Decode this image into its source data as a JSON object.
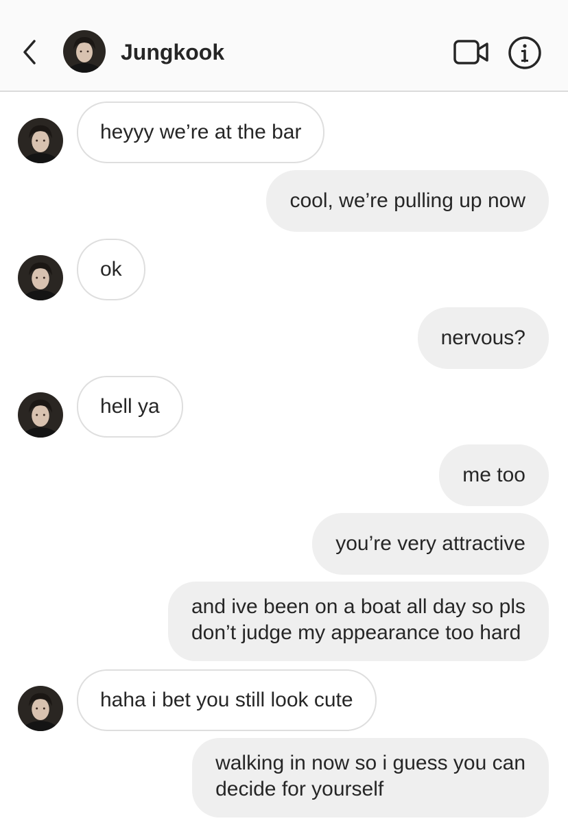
{
  "header": {
    "contact_name": "Jungkook"
  },
  "messages": [
    {
      "id": "m1",
      "side": "in",
      "text": "heyyy we’re at the bar"
    },
    {
      "id": "m2",
      "side": "out",
      "text": "cool, we’re pulling up now"
    },
    {
      "id": "m3",
      "side": "in",
      "text": "ok"
    },
    {
      "id": "m4",
      "side": "out",
      "text": "nervous?"
    },
    {
      "id": "m5",
      "side": "in",
      "text": "hell ya"
    },
    {
      "id": "m6",
      "side": "out",
      "text": "me too"
    },
    {
      "id": "m7",
      "side": "out",
      "text": "you’re very attractive"
    },
    {
      "id": "m8",
      "side": "out",
      "lines": [
        "and ive been on a boat all day so pls",
        "don’t judge my appearance too hard"
      ]
    },
    {
      "id": "m9",
      "side": "in",
      "text": "haha i bet you still look cute"
    },
    {
      "id": "m10",
      "side": "out",
      "lines": [
        "walking in now so i guess you can",
        "decide for yourself"
      ]
    }
  ],
  "icons": {
    "back": "chevron-left-icon",
    "video": "video-camera-icon",
    "info": "info-icon"
  },
  "colors": {
    "header_bg": "#fafafa",
    "incoming_bubble_border": "#dedede",
    "outgoing_bubble_bg": "#efefef",
    "text": "#262626"
  }
}
